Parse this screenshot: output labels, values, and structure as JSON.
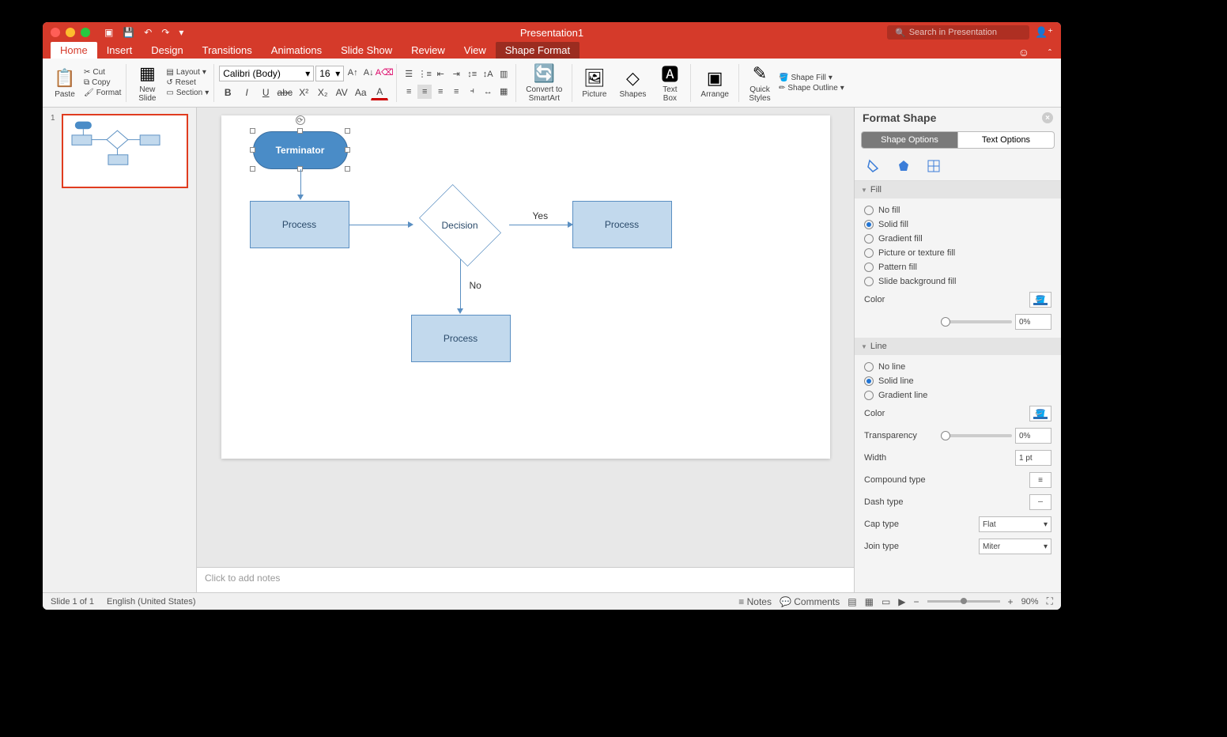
{
  "title": "Presentation1",
  "search_placeholder": "Search in Presentation",
  "tabs": [
    "Home",
    "Insert",
    "Design",
    "Transitions",
    "Animations",
    "Slide Show",
    "Review",
    "View",
    "Shape Format"
  ],
  "ribbon": {
    "paste": "Paste",
    "cut": "Cut",
    "copy": "Copy",
    "format": "Format",
    "new_slide": "New\nSlide",
    "layout": "Layout",
    "reset": "Reset",
    "section": "Section",
    "font_name": "Calibri (Body)",
    "font_size": "16",
    "convert": "Convert to\nSmartArt",
    "picture": "Picture",
    "shapes": "Shapes",
    "textbox": "Text\nBox",
    "arrange": "Arrange",
    "quick_styles": "Quick\nStyles",
    "shape_fill": "Shape Fill",
    "shape_outline": "Shape Outline"
  },
  "flowchart": {
    "terminator": "Terminator",
    "process": "Process",
    "decision": "Decision",
    "yes": "Yes",
    "no": "No"
  },
  "notes_placeholder": "Click to add notes",
  "pane": {
    "title": "Format Shape",
    "shape_options": "Shape Options",
    "text_options": "Text Options",
    "fill": {
      "header": "Fill",
      "no_fill": "No fill",
      "solid_fill": "Solid fill",
      "gradient_fill": "Gradient fill",
      "picture_fill": "Picture or texture fill",
      "pattern_fill": "Pattern fill",
      "slide_bg_fill": "Slide background fill",
      "color": "Color",
      "transparency_val": "0%"
    },
    "line": {
      "header": "Line",
      "no_line": "No line",
      "solid_line": "Solid line",
      "gradient_line": "Gradient line",
      "color": "Color",
      "transparency": "Transparency",
      "transparency_val": "0%",
      "width": "Width",
      "width_val": "1 pt",
      "compound": "Compound type",
      "dash": "Dash type",
      "cap": "Cap type",
      "cap_val": "Flat",
      "join": "Join type",
      "join_val": "Miter"
    }
  },
  "status": {
    "slide": "Slide 1 of 1",
    "lang": "English (United States)",
    "notes": "Notes",
    "comments": "Comments",
    "zoom": "90%"
  },
  "thumb_num": "1"
}
